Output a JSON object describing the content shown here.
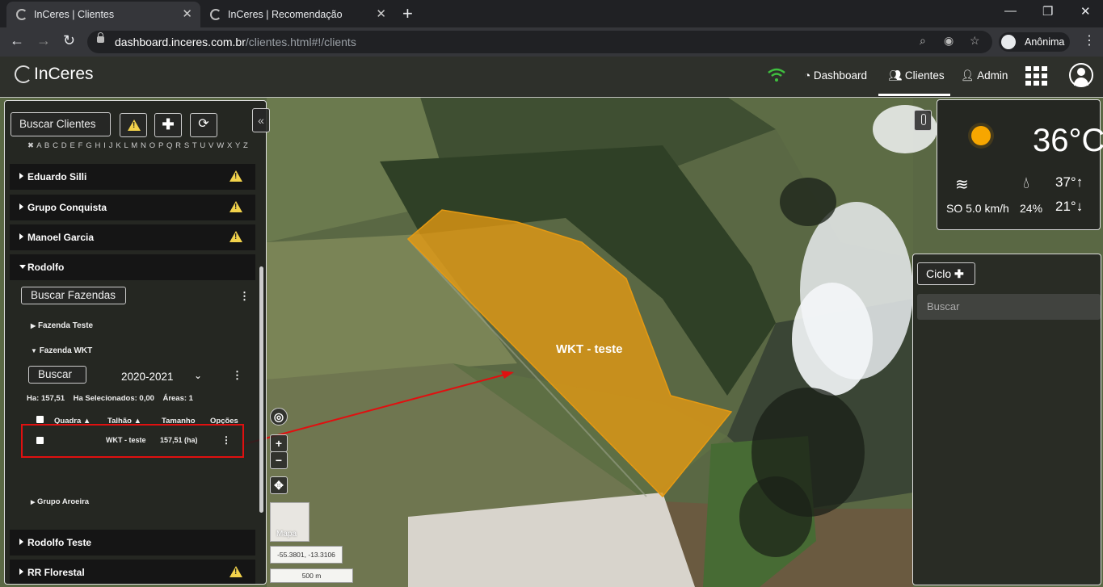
{
  "browser": {
    "tabs": [
      {
        "title": "InCeres | Clientes",
        "active": true
      },
      {
        "title": "InCeres | Recomendação",
        "active": false
      }
    ],
    "url_host": "dashboard.inceres.com.br",
    "url_path": "/clientes.html#!/clients",
    "profile_label": "Anônima"
  },
  "app": {
    "logo": "InCeres",
    "nav": {
      "dashboard": "Dashboard",
      "clientes": "Clientes",
      "admin": "Admin"
    }
  },
  "left_panel": {
    "search_clients_label": "Buscar Clientes",
    "alphabet": "A B C D E F G H I J K L M N O P Q R S T U V W X Y Z",
    "clients": [
      {
        "name": "Eduardo Silli",
        "warning": true
      },
      {
        "name": "Grupo Conquista",
        "warning": true
      },
      {
        "name": "Manoel Garcia",
        "warning": true
      },
      {
        "name": "Rodolfo",
        "warning": false,
        "expanded": true
      },
      {
        "name": "Rodolfo Teste",
        "warning": false
      },
      {
        "name": "RR Florestal",
        "warning": true
      }
    ],
    "search_farms_label": "Buscar Fazendas",
    "farms": [
      {
        "name": "Fazenda Teste",
        "expanded": false
      },
      {
        "name": "Fazenda WKT",
        "expanded": true
      },
      {
        "name": "Grupo Aroeira",
        "expanded": false
      }
    ],
    "farm_search_label": "Buscar",
    "season": "2020-2021",
    "summary": {
      "ha": "Ha: 157,51",
      "selected": "Ha Selecionados: 0,00",
      "areas": "Áreas: 1"
    },
    "table_headers": {
      "quadra": "Quadra",
      "talhao": "Talhão",
      "tamanho": "Tamanho",
      "opcoes": "Opções"
    },
    "table_rows": [
      {
        "talhao": "WKT - teste",
        "tamanho": "157,51 (ha)"
      }
    ]
  },
  "map": {
    "field_label": "WKT - teste",
    "coords": "-55.3801, -13.3106",
    "scale": "500 m",
    "minimap_label": "Mapa",
    "colors": {
      "field_fill": "#e69a12",
      "annotation": "#e01010"
    }
  },
  "weather": {
    "temp": "36°C",
    "wind": "SO 5.0 km/h",
    "humidity": "24%",
    "max": "37°",
    "min": "21°"
  },
  "ciclo": {
    "button_label": "Ciclo",
    "search_placeholder": "Buscar"
  }
}
